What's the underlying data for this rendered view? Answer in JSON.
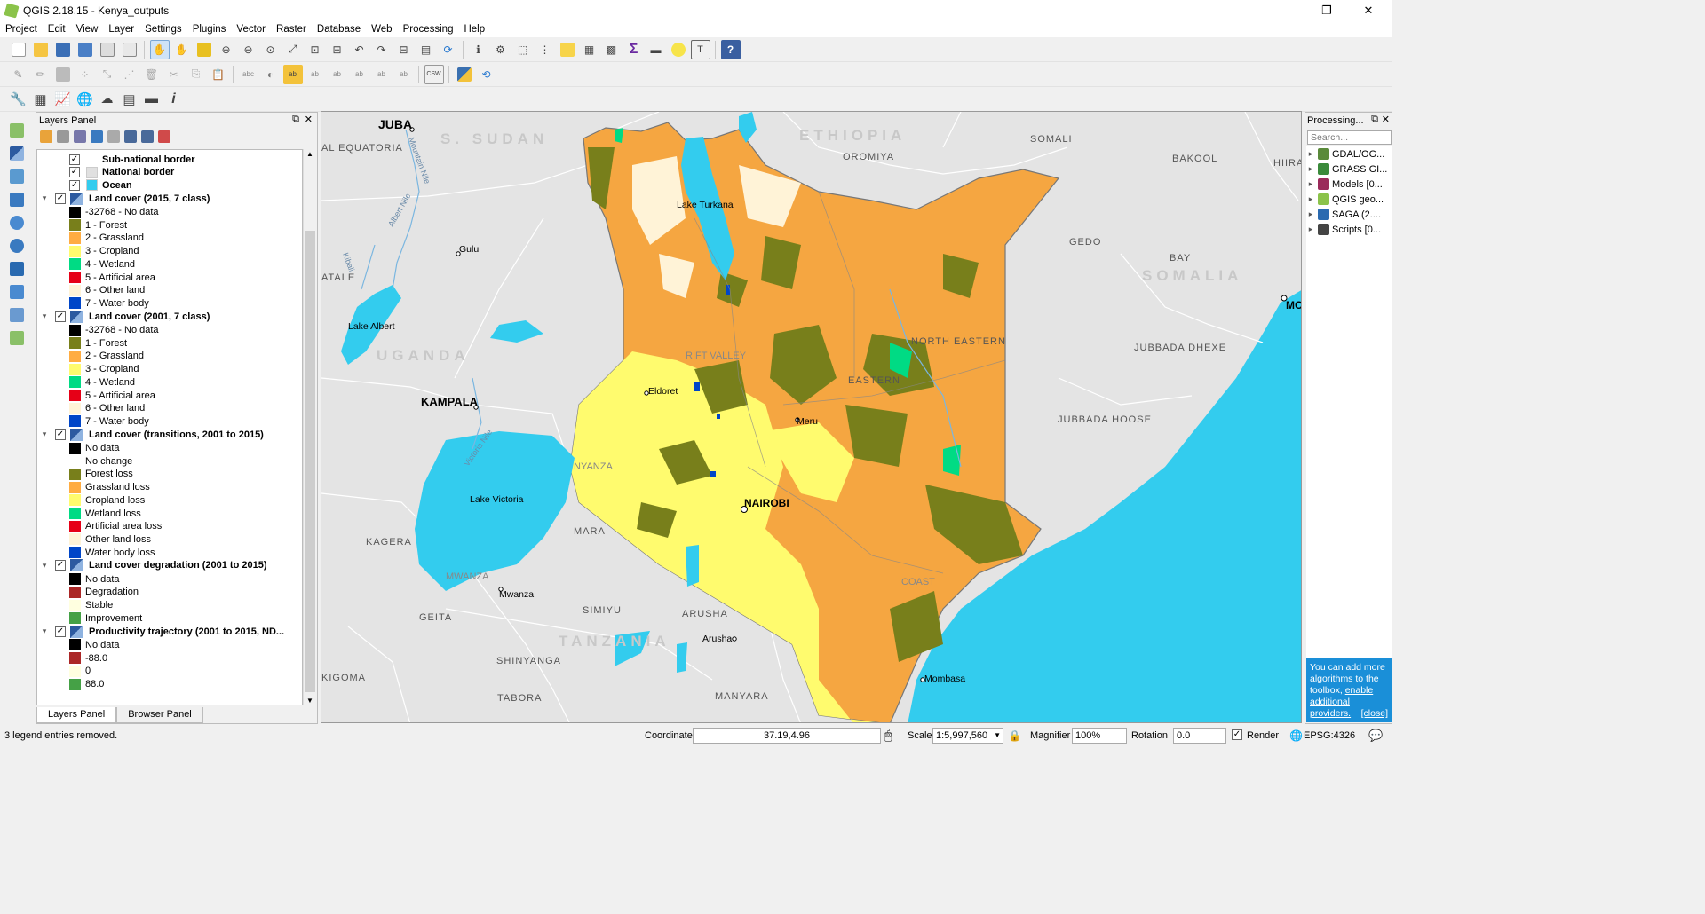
{
  "window": {
    "title": "QGIS 2.18.15 - Kenya_outputs",
    "min": "—",
    "max": "❐",
    "close": "✕"
  },
  "menu": [
    "Project",
    "Edit",
    "View",
    "Layer",
    "Settings",
    "Plugins",
    "Vector",
    "Raster",
    "Database",
    "Web",
    "Processing",
    "Help"
  ],
  "layers_panel": {
    "title": "Layers Panel",
    "tabs": [
      "Layers Panel",
      "Browser Panel"
    ]
  },
  "layer_rows": [
    {
      "type": "layer",
      "indent": 1,
      "checked": true,
      "bold": true,
      "label": "Sub-national border",
      "swatch": null
    },
    {
      "type": "layer",
      "indent": 1,
      "checked": true,
      "bold": true,
      "label": "National border",
      "swatch": "#e0e0e0"
    },
    {
      "type": "layer",
      "indent": 1,
      "checked": true,
      "bold": true,
      "label": "Ocean",
      "swatch": "#33ccee"
    },
    {
      "type": "group",
      "label": "Land cover (2015, 7 class)"
    },
    {
      "type": "leg",
      "label": "-32768 - No data",
      "swatch": "#000000"
    },
    {
      "type": "leg",
      "label": "1 - Forest",
      "swatch": "#787f1b"
    },
    {
      "type": "leg",
      "label": "2 - Grassland",
      "swatch": "#ffac42"
    },
    {
      "type": "leg",
      "label": "3 - Cropland",
      "swatch": "#fffb6e"
    },
    {
      "type": "leg",
      "label": "4 - Wetland",
      "swatch": "#00db84"
    },
    {
      "type": "leg",
      "label": "5 - Artificial area",
      "swatch": "#e60017"
    },
    {
      "type": "leg",
      "label": "6 - Other land",
      "swatch": "#fff3d7"
    },
    {
      "type": "leg",
      "label": "7 - Water body",
      "swatch": "#0046c8"
    },
    {
      "type": "group",
      "label": "Land cover (2001, 7 class)"
    },
    {
      "type": "leg",
      "label": "-32768 - No data",
      "swatch": "#000000"
    },
    {
      "type": "leg",
      "label": "1 - Forest",
      "swatch": "#787f1b"
    },
    {
      "type": "leg",
      "label": "2 - Grassland",
      "swatch": "#ffac42"
    },
    {
      "type": "leg",
      "label": "3 - Cropland",
      "swatch": "#fffb6e"
    },
    {
      "type": "leg",
      "label": "4 - Wetland",
      "swatch": "#00db84"
    },
    {
      "type": "leg",
      "label": "5 - Artificial area",
      "swatch": "#e60017"
    },
    {
      "type": "leg",
      "label": "6 - Other land",
      "swatch": "#fff3d7"
    },
    {
      "type": "leg",
      "label": "7 - Water body",
      "swatch": "#0046c8"
    },
    {
      "type": "group",
      "label": "Land cover (transitions, 2001 to 2015)"
    },
    {
      "type": "leg",
      "label": "No data",
      "swatch": "#000000"
    },
    {
      "type": "leg",
      "label": "No change",
      "swatch": "#ffffff"
    },
    {
      "type": "leg",
      "label": "Forest loss",
      "swatch": "#787f1b"
    },
    {
      "type": "leg",
      "label": "Grassland loss",
      "swatch": "#ffac42"
    },
    {
      "type": "leg",
      "label": "Cropland loss",
      "swatch": "#fffb6e"
    },
    {
      "type": "leg",
      "label": "Wetland loss",
      "swatch": "#00db84"
    },
    {
      "type": "leg",
      "label": "Artificial area loss",
      "swatch": "#e60017"
    },
    {
      "type": "leg",
      "label": "Other land loss",
      "swatch": "#fff3d7"
    },
    {
      "type": "leg",
      "label": "Water body loss",
      "swatch": "#0046c8"
    },
    {
      "type": "group",
      "label": "Land cover degradation (2001 to 2015)"
    },
    {
      "type": "leg",
      "label": "No data",
      "swatch": "#000000"
    },
    {
      "type": "leg",
      "label": "Degradation",
      "swatch": "#ab2727"
    },
    {
      "type": "leg",
      "label": "Stable",
      "swatch": "#ffffe0"
    },
    {
      "type": "leg",
      "label": "Improvement",
      "swatch": "#45a146"
    },
    {
      "type": "group",
      "label": "Productivity trajectory (2001 to 2015, ND..."
    },
    {
      "type": "leg",
      "label": "No data",
      "swatch": "#000000"
    },
    {
      "type": "leg",
      "label": "-88.0",
      "swatch": "#ab2727"
    },
    {
      "type": "leg",
      "label": "0",
      "swatch": "#ffffe0"
    },
    {
      "type": "leg",
      "label": "88.0",
      "swatch": "#45a146"
    }
  ],
  "processing": {
    "title": "Processing...",
    "search_placeholder": "Search...",
    "items": [
      {
        "label": "GDAL/OG...",
        "color": "#5a8a3a"
      },
      {
        "label": "GRASS GI...",
        "color": "#3a8a3a"
      },
      {
        "label": "Models [0...",
        "color": "#9a2a5a"
      },
      {
        "label": "QGIS geo...",
        "color": "#8bc34a"
      },
      {
        "label": "SAGA (2....",
        "color": "#2a6ab0"
      },
      {
        "label": "Scripts [0...",
        "color": "#444"
      }
    ],
    "note_text": "You can add more algorithms to the toolbox,",
    "note_link": "enable additional providers.",
    "note_close": "[close]"
  },
  "map_labels": [
    {
      "t": "JUBA",
      "b": true
    },
    {
      "t": "S. SUDAN"
    },
    {
      "t": "ETHIOPIA"
    },
    {
      "t": "AL EQUATORIA"
    },
    {
      "t": "OROMIYA"
    },
    {
      "t": "SOMALI"
    },
    {
      "t": "BAKOOL"
    },
    {
      "t": "HIIRA"
    },
    {
      "t": "Lake Turkana"
    },
    {
      "t": "Gulu"
    },
    {
      "t": "GEDO"
    },
    {
      "t": "BAY"
    },
    {
      "t": "SOMALIA"
    },
    {
      "t": "Lake Albert"
    },
    {
      "t": "UGANDA"
    },
    {
      "t": "RIFT VALLEY"
    },
    {
      "t": "NORTH EASTERN"
    },
    {
      "t": "JUBBADA DHEXE"
    },
    {
      "t": "Eldoret"
    },
    {
      "t": "KAMPALA",
      "b": true
    },
    {
      "t": "EASTERN"
    },
    {
      "t": "Meru"
    },
    {
      "t": "JUBBADA HOOSE"
    },
    {
      "t": "NYANZA"
    },
    {
      "t": "Lake Victoria"
    },
    {
      "t": "NAIROBI",
      "b": true
    },
    {
      "t": "KAGERA"
    },
    {
      "t": "MARA"
    },
    {
      "t": "MWANZA"
    },
    {
      "t": "Mwanza"
    },
    {
      "t": "COAST"
    },
    {
      "t": "GEITA"
    },
    {
      "t": "SIMIYU"
    },
    {
      "t": "ARUSHA"
    },
    {
      "t": "TANZANIA"
    },
    {
      "t": "Arusha"
    },
    {
      "t": "SHINYANGA"
    },
    {
      "t": "KIGOMA"
    },
    {
      "t": "Mombasa"
    },
    {
      "t": "TABORA"
    },
    {
      "t": "MANYARA"
    },
    {
      "t": "Mountain Nile"
    },
    {
      "t": "Albert Nile"
    },
    {
      "t": "Kibali"
    },
    {
      "t": "Victoria Nile"
    },
    {
      "t": "ATALE"
    },
    {
      "t": "MO",
      "b": true
    }
  ],
  "status": {
    "message": "3 legend entries removed.",
    "coord_label": "Coordinate",
    "coord_value": "37.19,4.96",
    "scale_label": "Scale",
    "scale_value": "1:5,997,560",
    "magnifier_label": "Magnifier",
    "magnifier_value": "100%",
    "rotation_label": "Rotation",
    "rotation_value": "0.0",
    "render_label": "Render",
    "epsg": "EPSG:4326"
  }
}
